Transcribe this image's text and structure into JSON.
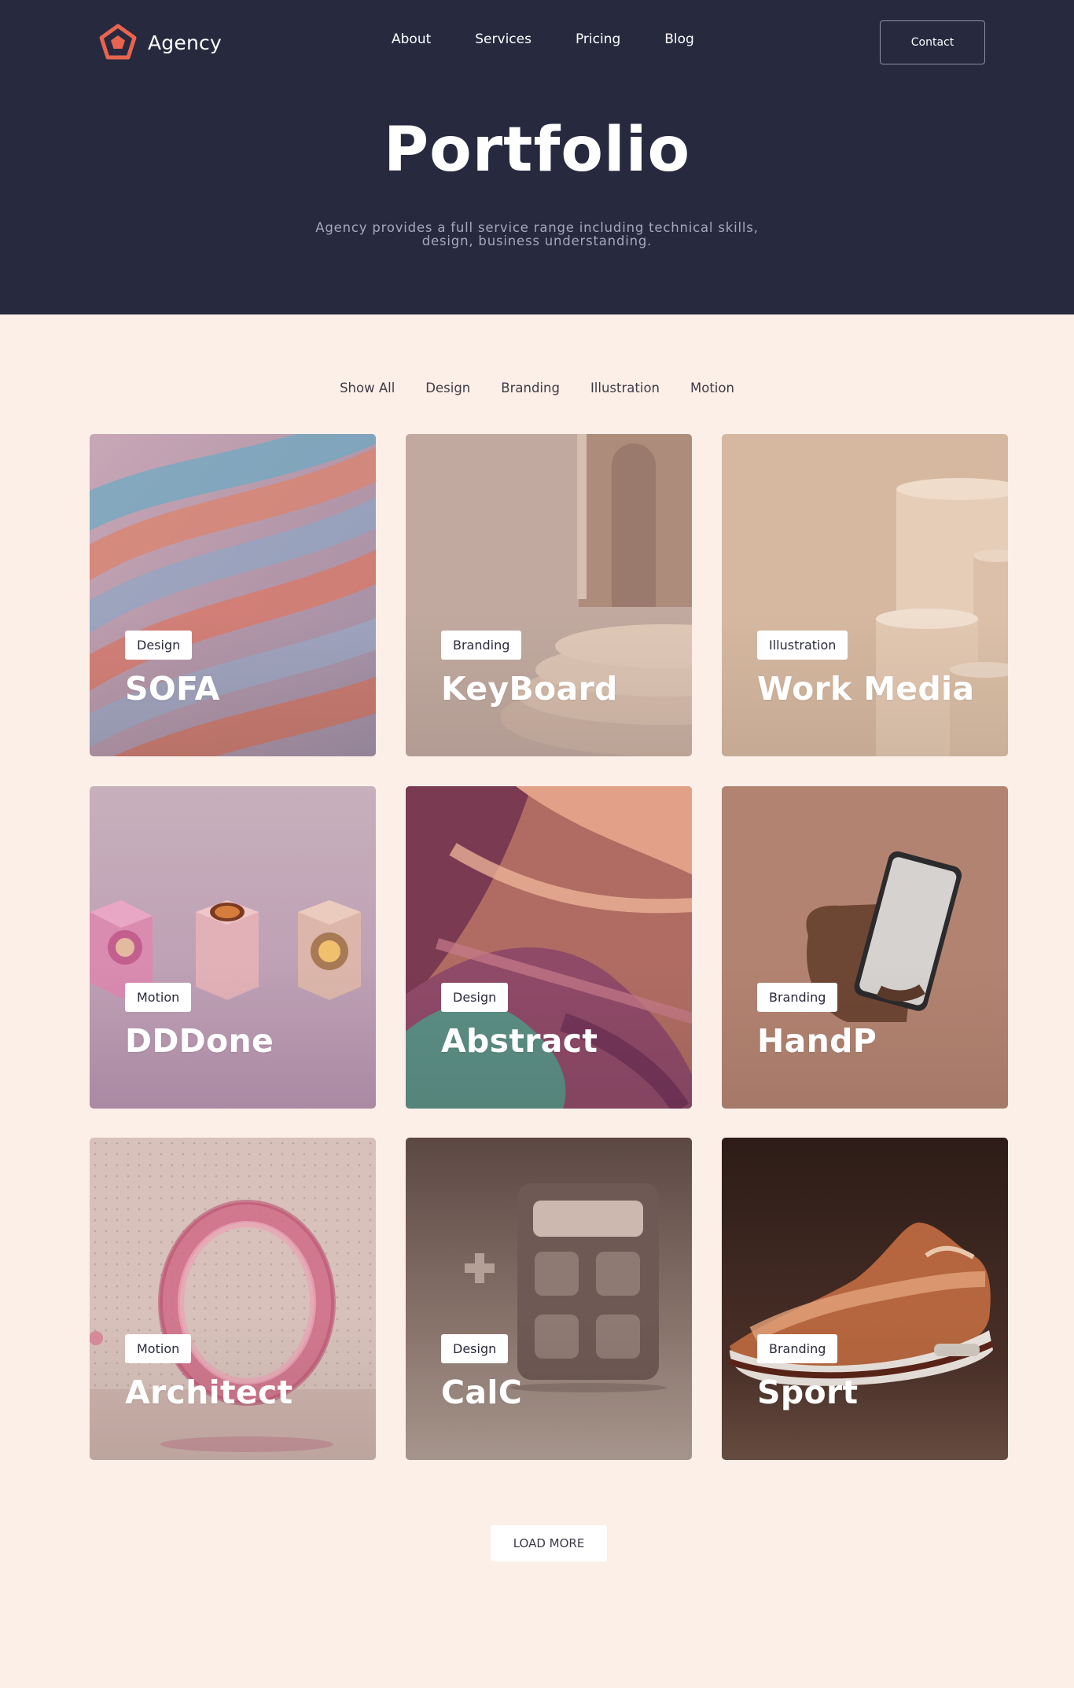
{
  "brand": {
    "name": "Agency",
    "logo_icon": "pentagon-logo-icon",
    "logo_color": "#e8644f"
  },
  "nav": {
    "items": [
      {
        "label": "About"
      },
      {
        "label": "Services"
      },
      {
        "label": "Pricing"
      },
      {
        "label": "Blog"
      }
    ],
    "contact_label": "Contact"
  },
  "hero": {
    "title": "Portfolio",
    "subtitle": "Agency provides a full service range including technical skills, design, business understanding.",
    "background": "#272a3f"
  },
  "filters": [
    {
      "label": "Show All"
    },
    {
      "label": "Design"
    },
    {
      "label": "Branding"
    },
    {
      "label": "Illustration"
    },
    {
      "label": "Motion"
    }
  ],
  "projects": [
    {
      "category": "Design",
      "title": "SOFA"
    },
    {
      "category": "Branding",
      "title": "KeyBoard"
    },
    {
      "category": "Illustration",
      "title": "Work Media"
    },
    {
      "category": "Motion",
      "title": "DDDone"
    },
    {
      "category": "Design",
      "title": "Abstract"
    },
    {
      "category": "Branding",
      "title": "HandP"
    },
    {
      "category": "Motion",
      "title": "Architect"
    },
    {
      "category": "Design",
      "title": "CalC"
    },
    {
      "category": "Branding",
      "title": "Sport"
    }
  ],
  "load_more_label": "LOAD MORE",
  "colors": {
    "page_bg": "#fcefe8",
    "accent": "#e8644f"
  }
}
